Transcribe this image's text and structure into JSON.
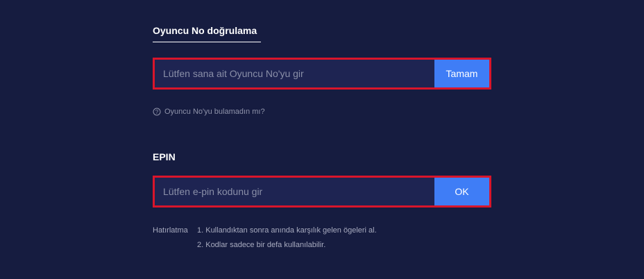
{
  "player_verification": {
    "title": "Oyuncu No doğrulama",
    "input_placeholder": "Lütfen sana ait Oyuncu No'yu gir",
    "input_value": "",
    "submit_label": "Tamam",
    "help_icon": "question-circle-icon",
    "help_text": "Oyuncu No'yu bulamadın mı?"
  },
  "epin": {
    "title": "EPIN",
    "input_placeholder": "Lütfen e-pin kodunu gir",
    "input_value": "",
    "submit_label": "OK"
  },
  "reminder": {
    "label": "Hatırlatma",
    "items": [
      "1. Kullandıktan sonra anında karşılık gelen ögeleri al.",
      "2. Kodlar sadece bir defa kullanılabilir."
    ]
  },
  "colors": {
    "background": "#161c40",
    "input_background": "#1e2452",
    "button": "#3f7df6",
    "highlight_border": "#d9152b"
  }
}
